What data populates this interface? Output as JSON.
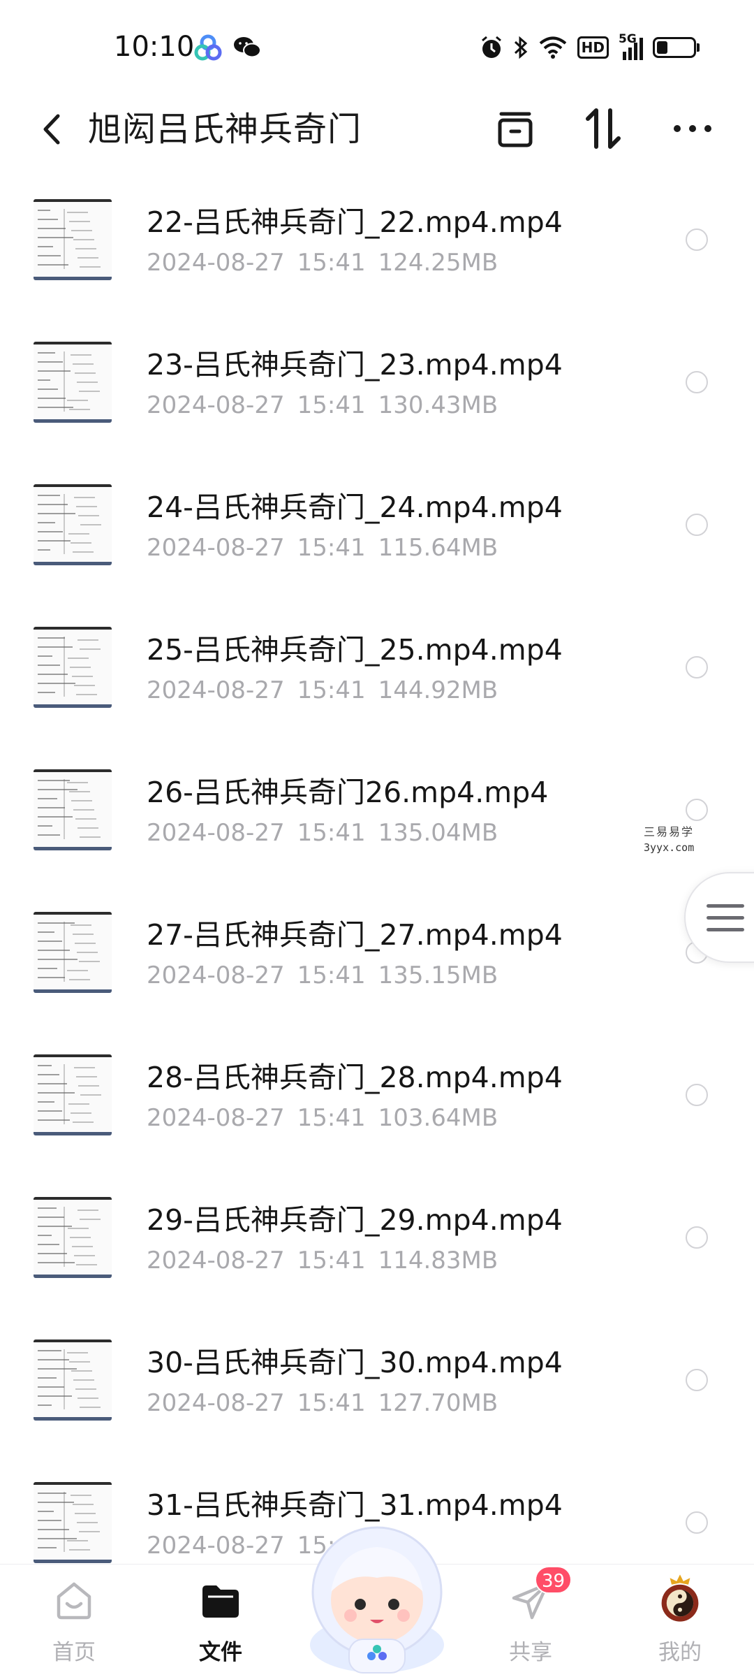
{
  "status_bar": {
    "time": "10:10",
    "app_icons": [
      "baidu-netdisk-icon",
      "wechat-icon"
    ],
    "right_icons": [
      "alarm-icon",
      "bluetooth-icon",
      "wifi-icon",
      "hd-icon",
      "5g-signal-icon",
      "battery-icon"
    ],
    "hd_label": "HD",
    "network_label": "5G",
    "battery_level": 0.3
  },
  "header": {
    "title": "旭闳吕氏神兵奇门"
  },
  "files": [
    {
      "name": "22-吕氏神兵奇门_22.mp4.mp4",
      "date": "2024-08-27",
      "time": "15:41",
      "size": "124.25MB"
    },
    {
      "name": "23-吕氏神兵奇门_23.mp4.mp4",
      "date": "2024-08-27",
      "time": "15:41",
      "size": "130.43MB"
    },
    {
      "name": "24-吕氏神兵奇门_24.mp4.mp4",
      "date": "2024-08-27",
      "time": "15:41",
      "size": "115.64MB"
    },
    {
      "name": "25-吕氏神兵奇门_25.mp4.mp4",
      "date": "2024-08-27",
      "time": "15:41",
      "size": "144.92MB"
    },
    {
      "name": "26-吕氏神兵奇门26.mp4.mp4",
      "date": "2024-08-27",
      "time": "15:41",
      "size": "135.04MB"
    },
    {
      "name": "27-吕氏神兵奇门_27.mp4.mp4",
      "date": "2024-08-27",
      "time": "15:41",
      "size": "135.15MB"
    },
    {
      "name": "28-吕氏神兵奇门_28.mp4.mp4",
      "date": "2024-08-27",
      "time": "15:41",
      "size": "103.64MB"
    },
    {
      "name": "29-吕氏神兵奇门_29.mp4.mp4",
      "date": "2024-08-27",
      "time": "15:41",
      "size": "114.83MB"
    },
    {
      "name": "30-吕氏神兵奇门_30.mp4.mp4",
      "date": "2024-08-27",
      "time": "15:41",
      "size": "127.70MB"
    },
    {
      "name": "31-吕氏神兵奇门_31.mp4.mp4",
      "date": "2024-08-27",
      "time": "15:41",
      "size": ""
    }
  ],
  "watermark": {
    "text": "三易易学",
    "url": "3yyx.com"
  },
  "bottom_nav": {
    "home": "首页",
    "files": "文件",
    "share": "共享",
    "mine": "我的",
    "share_badge": "39"
  },
  "colors": {
    "meta_text": "#a9a9ad",
    "badge": "#ff4d67",
    "active_nav": "#141414",
    "inactive_nav": "#b0b0b4"
  }
}
